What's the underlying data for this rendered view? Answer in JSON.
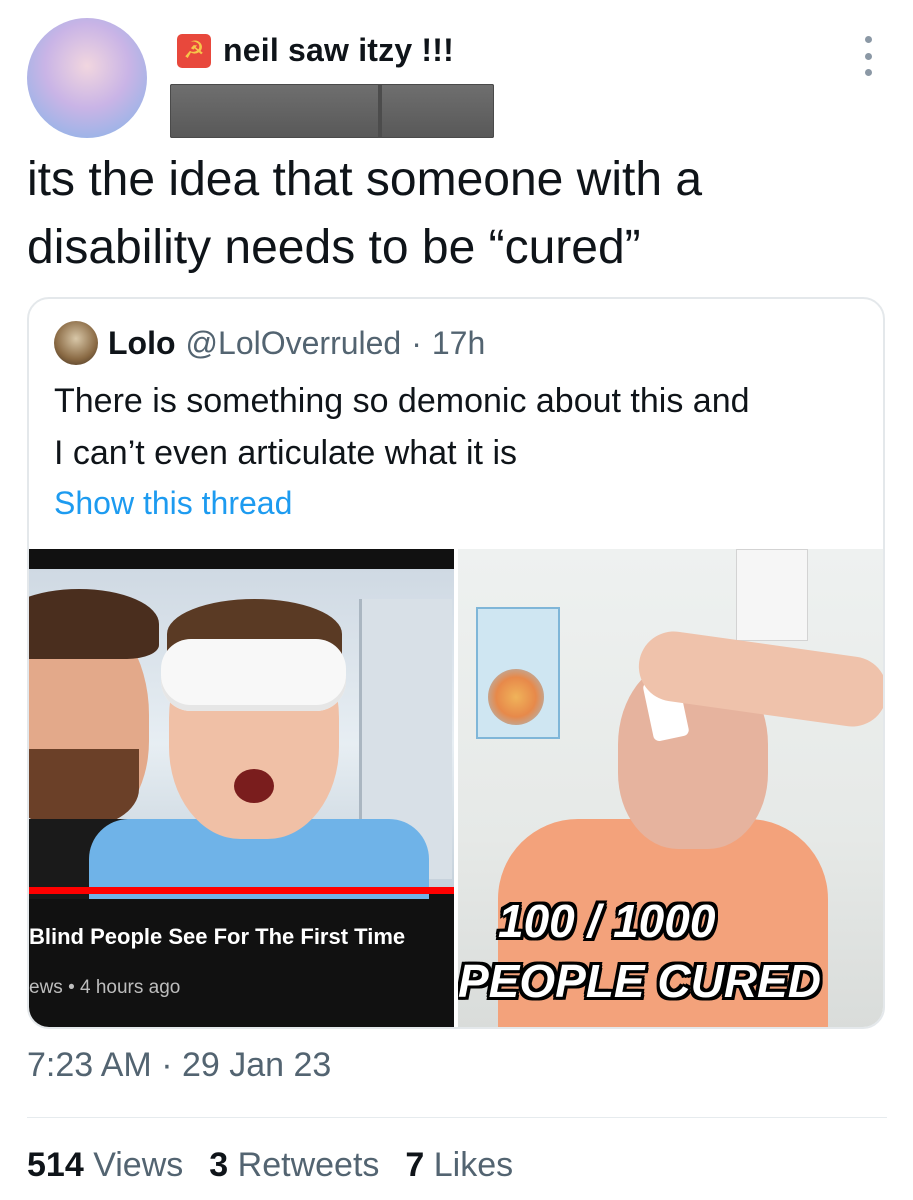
{
  "author": {
    "name": "neil saw itzy !!!",
    "flag_icon": "hammer-sickle-flag-icon"
  },
  "tweet": {
    "text_line1": "its the idea that someone with a",
    "text_line2": "disability needs to be “cured”"
  },
  "quote": {
    "name": "Lolo",
    "handle": "@LolOverruled",
    "separator": "·",
    "time": "17h",
    "text_line1": "There is something so demonic about this and",
    "text_line2": "I can’t even articulate what it is",
    "show_thread": "Show this thread",
    "media": {
      "left": {
        "video_title": "Blind People See For The First Time",
        "video_meta": "ews • 4 hours ago"
      },
      "right": {
        "overlay_line1": "100 / 1000",
        "overlay_line2": "PEOPLE CURED"
      }
    }
  },
  "footer": {
    "timestamp": "7:23 AM · 29 Jan 23",
    "views_count": "514",
    "views_label": "Views",
    "retweets_count": "3",
    "retweets_label": "Retweets",
    "likes_count": "7",
    "likes_label": "Likes"
  },
  "colors": {
    "link": "#1d9bf0",
    "secondary_text": "#536471",
    "primary_text": "#0f1419"
  }
}
